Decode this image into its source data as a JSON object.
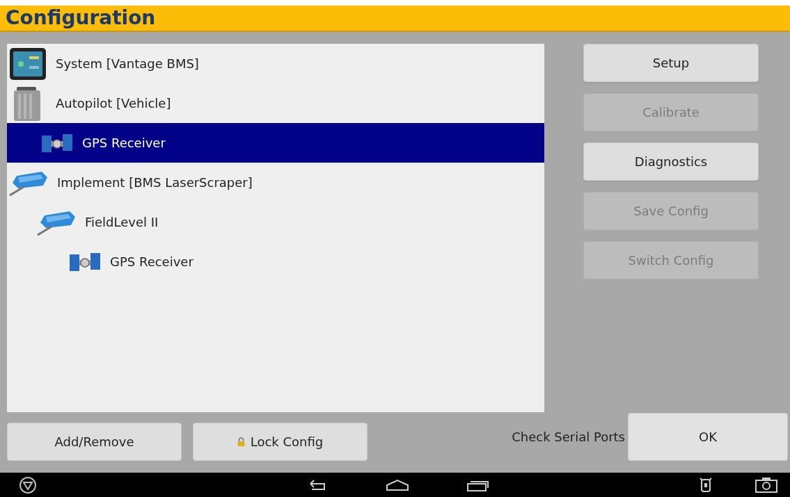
{
  "title": "Configuration",
  "tree": [
    {
      "label": "System [Vantage BMS]",
      "kind": "display",
      "selected": false
    },
    {
      "label": "Autopilot [Vehicle]",
      "kind": "controller",
      "selected": false,
      "children": [
        {
          "label": "GPS Receiver",
          "kind": "satellite",
          "selected": true
        }
      ]
    },
    {
      "label": "Implement [BMS LaserScraper]",
      "kind": "implement",
      "selected": false,
      "children": [
        {
          "label": "FieldLevel II",
          "kind": "implement",
          "selected": false,
          "children": [
            {
              "label": "GPS Receiver",
              "kind": "satellite",
              "selected": false
            }
          ]
        }
      ]
    }
  ],
  "side_buttons": [
    {
      "label": "Setup",
      "disabled": false
    },
    {
      "label": "Calibrate",
      "disabled": true
    },
    {
      "label": "Diagnostics",
      "disabled": false
    },
    {
      "label": "Save Config",
      "disabled": true
    },
    {
      "label": "Switch Config",
      "disabled": true
    }
  ],
  "bottom_buttons": [
    {
      "label": "Add/Remove",
      "kind": "plain"
    },
    {
      "label": "Lock Config",
      "kind": "lock"
    }
  ],
  "check_serial_ports": "Check Serial Ports",
  "ok_button": "OK"
}
